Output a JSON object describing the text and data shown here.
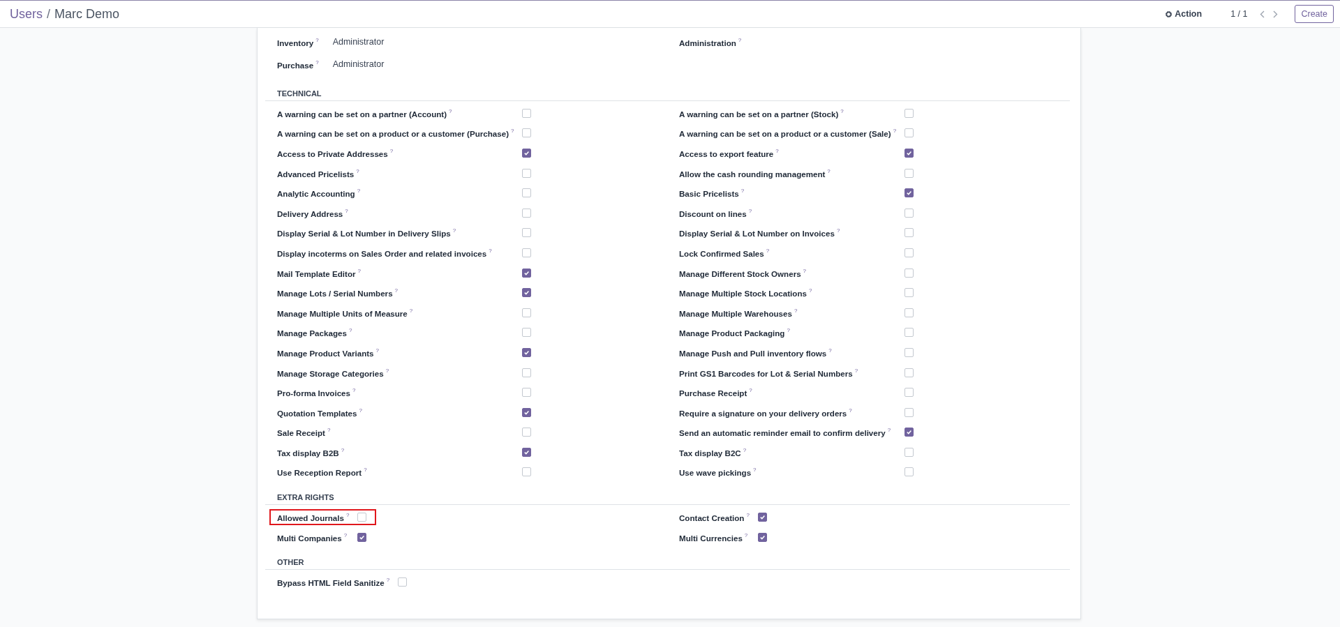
{
  "breadcrumb": {
    "parent": "Users",
    "separator": "/",
    "current": "Marc Demo"
  },
  "toolbar": {
    "action": "Action",
    "pager": "1 / 1",
    "create": "Create"
  },
  "access_rights": {
    "left": [
      {
        "label": "Inventory",
        "help": "?",
        "value": "Administrator"
      },
      {
        "label": "Purchase",
        "help": "?",
        "value": "Administrator"
      }
    ],
    "right": [
      {
        "label": "Administration",
        "help": "?"
      }
    ]
  },
  "sections": [
    {
      "title": "TECHNICAL",
      "left": [
        {
          "label": "A warning can be set on a partner (Account)",
          "help": "?",
          "checked": false
        },
        {
          "label": "A warning can be set on a product or a customer (Purchase)",
          "help": "?",
          "checked": false
        },
        {
          "label": "Access to Private Addresses",
          "help": "?",
          "checked": true
        },
        {
          "label": "Advanced Pricelists",
          "help": "?",
          "checked": false
        },
        {
          "label": "Analytic Accounting",
          "help": "?",
          "checked": false
        },
        {
          "label": "Delivery Address",
          "help": "?",
          "checked": false
        },
        {
          "label": "Display Serial & Lot Number in Delivery Slips",
          "help": "?",
          "checked": false
        },
        {
          "label": "Display incoterms on Sales Order and related invoices",
          "help": "?",
          "checked": false
        },
        {
          "label": "Mail Template Editor",
          "help": "?",
          "checked": true
        },
        {
          "label": "Manage Lots / Serial Numbers",
          "help": "?",
          "checked": true
        },
        {
          "label": "Manage Multiple Units of Measure",
          "help": "?",
          "checked": false
        },
        {
          "label": "Manage Packages",
          "help": "?",
          "checked": false
        },
        {
          "label": "Manage Product Variants",
          "help": "?",
          "checked": true
        },
        {
          "label": "Manage Storage Categories",
          "help": "?",
          "checked": false
        },
        {
          "label": "Pro-forma Invoices",
          "help": "?",
          "checked": false
        },
        {
          "label": "Quotation Templates",
          "help": "?",
          "checked": true
        },
        {
          "label": "Sale Receipt",
          "help": "?",
          "checked": false
        },
        {
          "label": "Tax display B2B",
          "help": "?",
          "checked": true
        },
        {
          "label": "Use Reception Report",
          "help": "?",
          "checked": false
        }
      ],
      "right": [
        {
          "label": "A warning can be set on a partner (Stock)",
          "help": "?",
          "checked": false
        },
        {
          "label": "A warning can be set on a product or a customer (Sale)",
          "help": "?",
          "checked": false
        },
        {
          "label": "Access to export feature",
          "help": "?",
          "checked": true
        },
        {
          "label": "Allow the cash rounding management",
          "help": "?",
          "checked": false
        },
        {
          "label": "Basic Pricelists",
          "help": "?",
          "checked": true
        },
        {
          "label": "Discount on lines",
          "help": "?",
          "checked": false
        },
        {
          "label": "Display Serial & Lot Number on Invoices",
          "help": "?",
          "checked": false
        },
        {
          "label": "Lock Confirmed Sales",
          "help": "?",
          "checked": false
        },
        {
          "label": "Manage Different Stock Owners",
          "help": "?",
          "checked": false
        },
        {
          "label": "Manage Multiple Stock Locations",
          "help": "?",
          "checked": false
        },
        {
          "label": "Manage Multiple Warehouses",
          "help": "?",
          "checked": false
        },
        {
          "label": "Manage Product Packaging",
          "help": "?",
          "checked": false
        },
        {
          "label": "Manage Push and Pull inventory flows",
          "help": "?",
          "checked": false
        },
        {
          "label": "Print GS1 Barcodes for Lot & Serial Numbers",
          "help": "?",
          "checked": false
        },
        {
          "label": "Purchase Receipt",
          "help": "?",
          "checked": false
        },
        {
          "label": "Require a signature on your delivery orders",
          "help": "?",
          "checked": false
        },
        {
          "label": "Send an automatic reminder email to confirm delivery",
          "help": "?",
          "checked": true
        },
        {
          "label": "Tax display B2C",
          "help": "?",
          "checked": false
        },
        {
          "label": "Use wave pickings",
          "help": "?",
          "checked": false
        }
      ]
    },
    {
      "title": "EXTRA RIGHTS",
      "left": [
        {
          "label": "Allowed Journals",
          "help": "?",
          "checked": false,
          "highlighted": true
        },
        {
          "label": "Multi Companies",
          "help": "?",
          "checked": true
        }
      ],
      "right": [
        {
          "label": "Contact Creation",
          "help": "?",
          "checked": true
        },
        {
          "label": "Multi Currencies",
          "help": "?",
          "checked": true
        }
      ]
    },
    {
      "title": "OTHER",
      "left": [
        {
          "label": "Bypass HTML Field Sanitize",
          "help": "?",
          "checked": false
        }
      ]
    }
  ]
}
